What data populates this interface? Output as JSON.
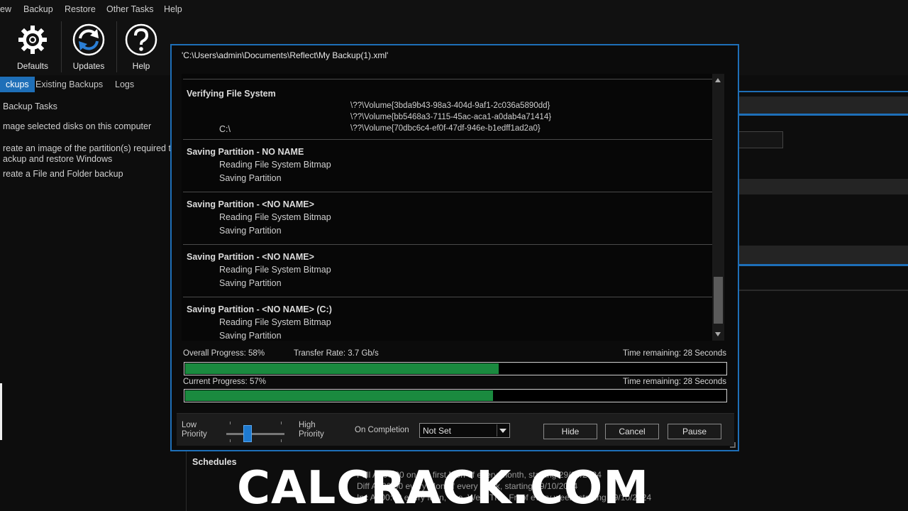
{
  "menu": [
    "ew",
    "Backup",
    "Restore",
    "Other Tasks",
    "Help"
  ],
  "toolbar": {
    "defaults": "Defaults",
    "updates": "Updates",
    "help": "Help"
  },
  "tabs": [
    "ckups",
    "Existing Backups",
    "Logs"
  ],
  "left_panel": {
    "header": "Backup Tasks",
    "item1": "mage selected disks on this computer",
    "item2a": "reate an image of the partition(s) required t",
    "item2b": "ackup and restore Windows",
    "item3": "reate a File and Folder backup"
  },
  "dialog": {
    "title": "'C:\\Users\\admin\\Documents\\Reflect\\My Backup(1).xml'",
    "verify": {
      "heading": "Verifying File System",
      "drive": "C:\\",
      "volumes": [
        "\\??\\Volume{3bda9b43-98a3-404d-9af1-2c036a5890dd}",
        "\\??\\Volume{bb5468a3-7115-45ac-aca1-a0dab4a71414}",
        "\\??\\Volume{70dbc6c4-ef0f-47df-946e-b1edff1ad2a0}"
      ]
    },
    "sections": [
      {
        "heading": "Saving Partition - NO NAME",
        "step1": "Reading File System Bitmap",
        "step2": "Saving Partition"
      },
      {
        "heading": "Saving Partition - <NO NAME>",
        "step1": "Reading File System Bitmap",
        "step2": "Saving Partition"
      },
      {
        "heading": "Saving Partition - <NO NAME>",
        "step1": "Reading File System Bitmap",
        "step2": "Saving Partition"
      },
      {
        "heading": "Saving Partition - <NO NAME> (C:)",
        "step1": "Reading File System Bitmap",
        "step2": "Saving Partition"
      }
    ],
    "overall": {
      "label": "Overall Progress:  58%",
      "percent": 58,
      "rate": "Transfer Rate: 3.7 Gb/s",
      "time": "Time remaining: 28 Seconds"
    },
    "current": {
      "label": "Current Progress:  57%",
      "percent": 57,
      "time": "Time remaining: 28 Seconds"
    },
    "priority_low": [
      "Low",
      "Priority"
    ],
    "priority_high": [
      "High",
      "Priority"
    ],
    "on_completion_label": "On Completion",
    "on_completion_value": "Not Set",
    "buttons": {
      "hide": "Hide",
      "cancel": "Cancel",
      "pause": "Pause"
    }
  },
  "schedules": {
    "title": "Schedules",
    "lines": [
      "Full   At 00:00 on the first Mon of every month, starting 29/10/2024",
      "Diff   At 00:00 every Mon of every week, starting 29/10/2024",
      "Inc    At 00:00 every Mon, Tue, Wed, Thu, Fri of every week, starting 29/10/2024"
    ]
  },
  "watermark": "CALCRACK.COM",
  "colors": {
    "accent": "#1e6fb8",
    "progress": "#1a8a3f",
    "background": "#0d0d0d"
  }
}
